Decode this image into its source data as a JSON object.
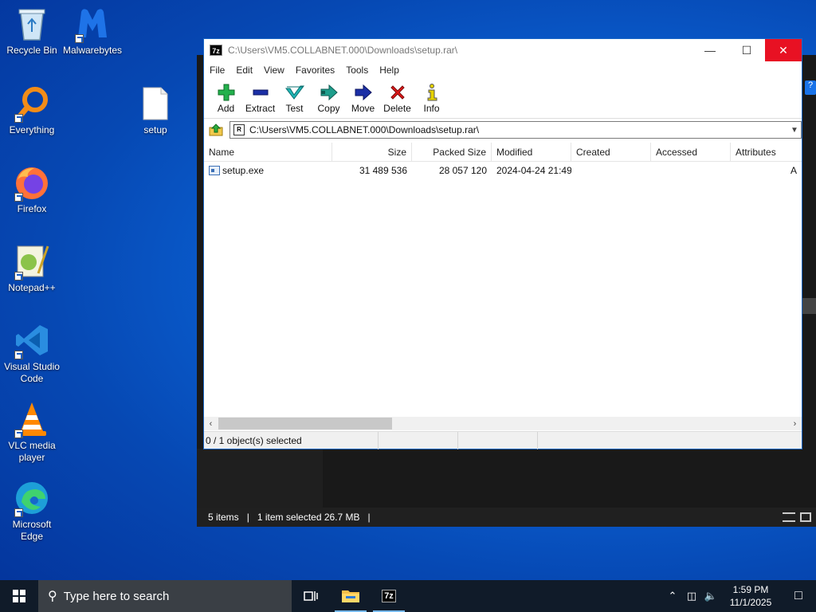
{
  "desktop": {
    "icons": [
      {
        "label": "Recycle Bin",
        "name": "recycle-bin-icon"
      },
      {
        "label": "Malwarebytes",
        "name": "malwarebytes-icon"
      },
      {
        "label": "Everything",
        "name": "everything-icon"
      },
      {
        "label": "setup",
        "name": "setup-file-icon"
      },
      {
        "label": "Firefox",
        "name": "firefox-icon"
      },
      {
        "label": "Notepad++",
        "name": "notepadpp-icon"
      },
      {
        "label": "Visual Studio Code",
        "name": "vscode-icon"
      },
      {
        "label": "VLC media player",
        "name": "vlc-icon"
      },
      {
        "label": "Microsoft Edge",
        "name": "edge-icon"
      }
    ]
  },
  "bg_window": {
    "status_items": "5 items",
    "status_selected": "1 item selected  26.7 MB",
    "help": "?"
  },
  "zip": {
    "app_icon": "7z",
    "title": "C:\\Users\\VM5.COLLABNET.000\\Downloads\\setup.rar\\",
    "controls": {
      "minimize": "—",
      "maximize": "☐",
      "close": "✕"
    },
    "menu": [
      "File",
      "Edit",
      "View",
      "Favorites",
      "Tools",
      "Help"
    ],
    "toolbar": [
      "Add",
      "Extract",
      "Test",
      "Copy",
      "Move",
      "Delete",
      "Info"
    ],
    "address": "C:\\Users\\VM5.COLLABNET.000\\Downloads\\setup.rar\\",
    "columns": [
      "Name",
      "Size",
      "Packed Size",
      "Modified",
      "Created",
      "Accessed",
      "Attributes"
    ],
    "files": [
      {
        "name": "setup.exe",
        "size": "31 489 536",
        "packed": "28 057 120",
        "modified": "2024-04-24 21:49",
        "created": "",
        "accessed": "",
        "attributes": "A"
      }
    ],
    "status": "0 / 1 object(s) selected"
  },
  "taskbar": {
    "search_placeholder": "Type here to search",
    "time": "1:59 PM",
    "date": "11/1/2025",
    "zip_label": "7z"
  },
  "colors": {
    "close_red": "#e81123",
    "taskbar": "#101b29",
    "accent": "#76b9ed"
  }
}
